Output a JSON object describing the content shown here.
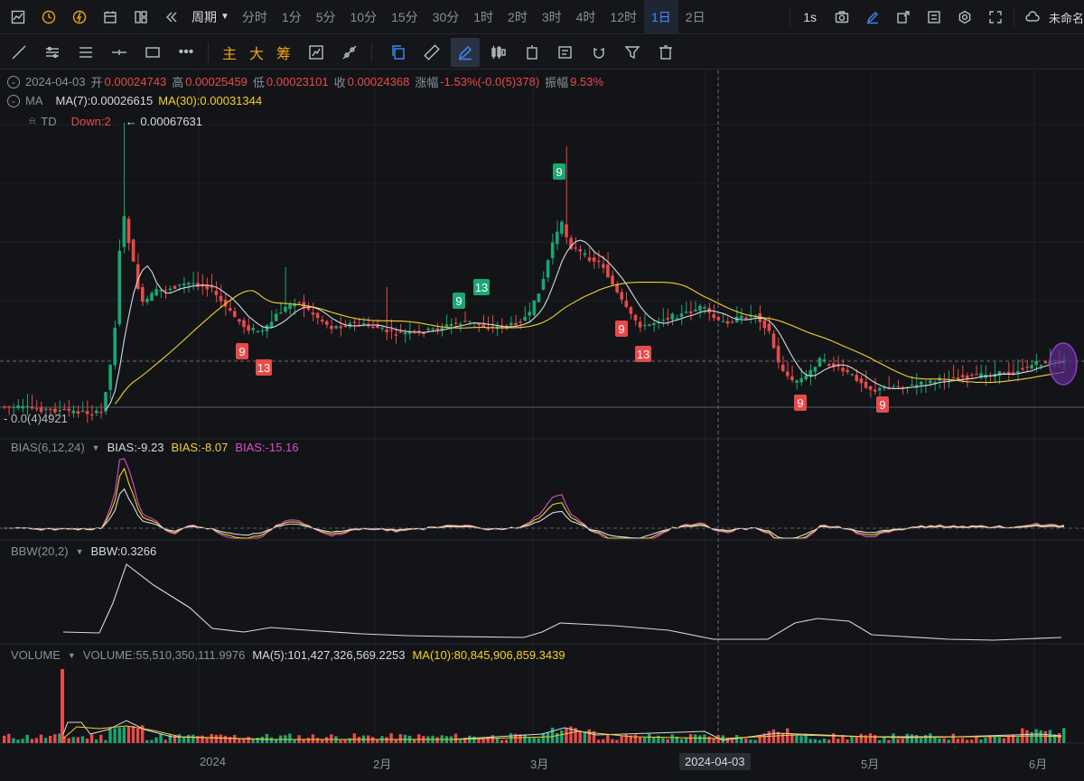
{
  "toolbar": {
    "period_label": "周期",
    "intervals": [
      "分时",
      "1分",
      "5分",
      "10分",
      "15分",
      "30分",
      "1时",
      "2时",
      "3时",
      "4时",
      "12时",
      "1日",
      "2日"
    ],
    "active_interval": "1日",
    "refresh_label": "1s",
    "unnamed_label": "未命名"
  },
  "drawbar": {
    "text_tools": [
      "主",
      "大",
      "筹"
    ]
  },
  "legend": {
    "date": "2024-04-03",
    "open_label": "开",
    "open": "0.00024743",
    "high_label": "高",
    "high": "0.00025459",
    "low_label": "低",
    "low": "0.00023101",
    "close_label": "收",
    "close": "0.00024368",
    "change_label": "涨幅",
    "change": "-1.53%(-0.0(5)378)",
    "amplitude_label": "振幅",
    "amplitude": "9.53%",
    "ma_name": "MA",
    "ma7": "MA(7):0.00026615",
    "ma30": "MA(30):0.00031344",
    "td_name": "TD",
    "td_value": "Down:2",
    "max_price": "← 0.00067631",
    "min_price": "- 0.0(4)4921"
  },
  "td_marks": [
    {
      "label": "9",
      "kind": "up"
    },
    {
      "label": "13",
      "kind": "up"
    },
    {
      "label": "9",
      "kind": "up"
    },
    {
      "label": "9",
      "kind": "down"
    },
    {
      "label": "13",
      "kind": "down"
    },
    {
      "label": "9",
      "kind": "down"
    },
    {
      "label": "13",
      "kind": "down"
    },
    {
      "label": "9",
      "kind": "down"
    },
    {
      "label": "9",
      "kind": "down"
    }
  ],
  "bias": {
    "name": "BIAS(6,12,24)",
    "b1": "BIAS:-9.23",
    "b2": "BIAS:-8.07",
    "b3": "BIAS:-15.16"
  },
  "bbw": {
    "name": "BBW(20,2)",
    "value": "BBW:0.3266"
  },
  "volume": {
    "name": "VOLUME",
    "value": "VOLUME:55,510,350,111.9976",
    "ma5": "MA(5):101,427,326,569.2253",
    "ma10": "MA(10):80,845,906,859.3439"
  },
  "x_axis": [
    "2024",
    "2月",
    "3月",
    "5月",
    "6月"
  ],
  "crosshair_date": "2024-04-03",
  "colors": {
    "up": "#1ba672",
    "down": "#e84a4a",
    "ma7": "#d6d9df",
    "ma30": "#f2d02f",
    "bias3": "#d452c8",
    "accent": "#3f8cff"
  }
}
